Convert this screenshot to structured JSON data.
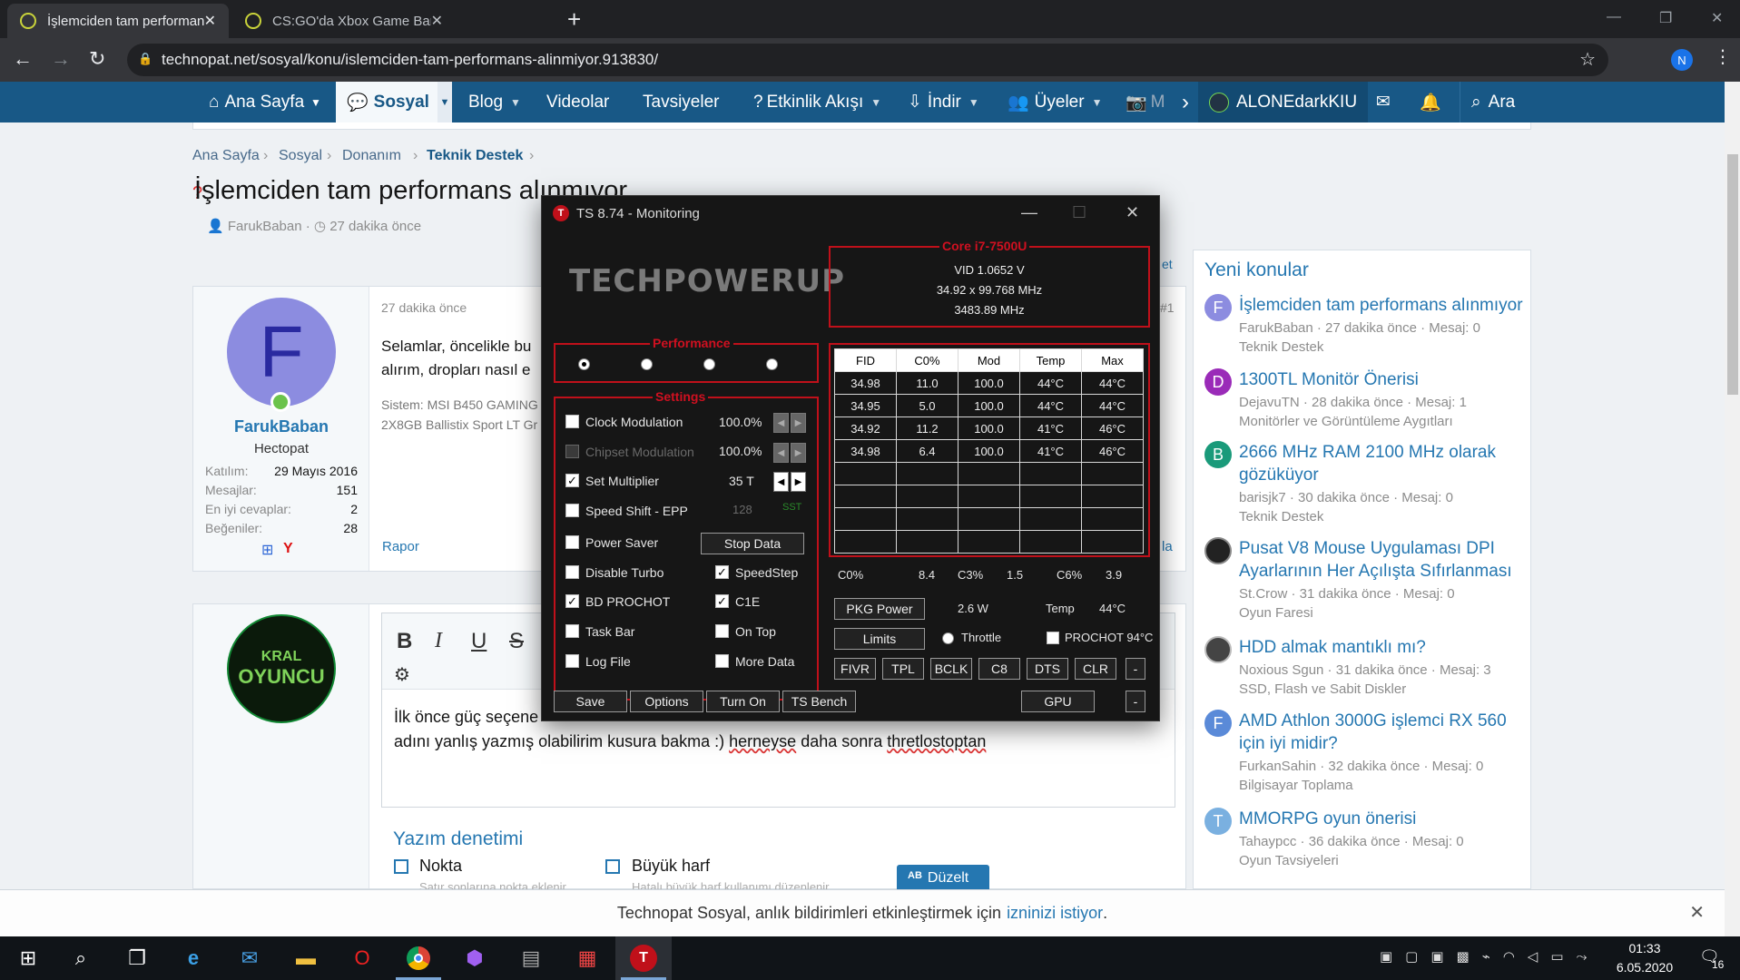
{
  "browser": {
    "tabs": [
      {
        "label": "İşlemciden tam performans alınm"
      },
      {
        "label": "CS:GO'da Xbox Game Bar'dan ka"
      }
    ],
    "url": "technopat.net/sosyal/konu/islemciden-tam-performans-alinmiyor.913830/",
    "profile_initial": "N"
  },
  "sitenav": {
    "items": [
      "Ana Sayfa",
      "Sosyal",
      "Blog",
      "Videolar",
      "Tavsiyeler",
      "Etkinlik Akışı",
      "İndir",
      "Üyeler",
      "M"
    ],
    "user": "ALONEdarkKIU",
    "search": "Ara"
  },
  "breadcrumb": [
    "Ana Sayfa",
    "Sosyal",
    "Donanım",
    "Teknik Destek"
  ],
  "thread": {
    "title": "İşlemciden tam performans alınmıyor",
    "author": "FarukBaban",
    "time": "27 dakika önce"
  },
  "post": {
    "time": "27 dakika önce",
    "number": "#1",
    "avatar_initial": "F",
    "username": "FarukBaban",
    "rank": "Hectopat",
    "stats": [
      {
        "label": "Katılım:",
        "value": "29 Mayıs 2016"
      },
      {
        "label": "Mesajlar:",
        "value": "151"
      },
      {
        "label": "En iyi cevaplar:",
        "value": "2"
      },
      {
        "label": "Beğeniler:",
        "value": "28"
      }
    ],
    "text_line1": "Selamlar, öncelikle bu",
    "text_line2": "alırım, dropları nasıl e",
    "system_line1": "Sistem: MSI B450 GAMING",
    "system_line2": "2X8GB Ballistix Sport LT Gr",
    "report": "Rapor",
    "right_fragment": "la",
    "tab_fragment": "et"
  },
  "reply": {
    "avatar_text1": "KRAL",
    "avatar_text2": "OYUNCU",
    "line1": "İlk önce güç seçene",
    "line2_pre": "adını yanlış yazmış olabilirim kusura bakma :) ",
    "line2_w1": "herneyse",
    "line2_mid": " daha sonra ",
    "line2_w2": "thretlostoptan"
  },
  "spellcheck": {
    "title": "Yazım denetimi",
    "opt1": "Nokta",
    "opt1_sub": "Satır sonlarına nokta eklenir",
    "opt2": "Büyük harf",
    "opt2_sub": "Hatalı büyük harf kullanımı düzenlenir",
    "fix": "Düzelt"
  },
  "sidebar": {
    "title": "Yeni konular",
    "items": [
      {
        "initial": "F",
        "color": "#8c8ce0",
        "title": "İşlemciden tam performans alınmıyor",
        "meta1": "FarukBaban · 27 dakika önce · Mesaj: 0",
        "meta2": "Teknik Destek"
      },
      {
        "initial": "D",
        "color": "#9a2bb8",
        "title": "1300TL Monitör Önerisi",
        "meta1": "DejavuTN · 28 dakika önce · Mesaj: 1",
        "meta2": "Monitörler ve Görüntüleme Aygıtları"
      },
      {
        "initial": "B",
        "color": "#1a9a7a",
        "title": "2666 MHz RAM 2100 MHz olarak gözüküyor",
        "meta1": "barisjk7 · 30 dakika önce · Mesaj: 0",
        "meta2": "Teknik Destek"
      },
      {
        "initial": "",
        "color": "#222",
        "title": "Pusat V8 Mouse Uygulaması DPI Ayarlarının Her Açılışta Sıfırlanması",
        "meta1": "St.Crow · 31 dakika önce · Mesaj: 0",
        "meta2": "Oyun Faresi"
      },
      {
        "initial": "",
        "color": "#444",
        "title": "HDD almak mantıklı mı?",
        "meta1": "Noxious Sgun · 31 dakika önce · Mesaj: 3",
        "meta2": "SSD, Flash ve Sabit Diskler"
      },
      {
        "initial": "F",
        "color": "#5a8ad8",
        "title": "AMD Athlon 3000G işlemci RX 560 için iyi midir?",
        "meta1": "FurkanSahin · 32 dakika önce · Mesaj: 0",
        "meta2": "Bilgisayar Toplama"
      },
      {
        "initial": "T",
        "color": "#7ab0e0",
        "title": "MMORPG oyun önerisi",
        "meta1": "Tahaypcc · 36 dakika önce · Mesaj: 0",
        "meta2": "Oyun Tavsiyeleri"
      }
    ]
  },
  "notice": {
    "text": "Technopat Sosyal, anlık bildirimleri etkinleştirmek için",
    "link": "izninizi istiyor",
    "end": "."
  },
  "ts": {
    "title": "TS 8.74 - Monitoring",
    "logo_text": "TECHPOWERUP",
    "cpu": "Core i7-7500U",
    "vid": "VID  1.0652 V",
    "mult": "34.92 x 99.768 MHz",
    "freq": "3483.89 MHz",
    "performance_label": "Performance",
    "settings_label": "Settings",
    "settings": [
      {
        "label": "Clock Modulation",
        "value": "100.0%",
        "checked": false,
        "disabled": false
      },
      {
        "label": "Chipset Modulation",
        "value": "100.0%",
        "checked": false,
        "disabled": true
      },
      {
        "label": "Set Multiplier",
        "value": "35 T",
        "checked": true,
        "disabled": false
      },
      {
        "label": "Speed Shift - EPP",
        "value": "128",
        "extra": "SST",
        "checked": false,
        "disabled": false
      }
    ],
    "checks_left": [
      {
        "label": "Power Saver",
        "checked": false
      },
      {
        "label": "Disable Turbo",
        "checked": false
      },
      {
        "label": "BD PROCHOT",
        "checked": true
      },
      {
        "label": "Task Bar",
        "checked": false
      },
      {
        "label": "Log File",
        "checked": false
      }
    ],
    "checks_right": [
      {
        "label": "SpeedStep",
        "checked": true
      },
      {
        "label": "C1E",
        "checked": true
      },
      {
        "label": "On Top",
        "checked": false
      },
      {
        "label": "More Data",
        "checked": false
      }
    ],
    "stop_data": "Stop Data",
    "table_header": [
      "FID",
      "C0%",
      "Mod",
      "Temp",
      "Max"
    ],
    "table_rows": [
      [
        "34.98",
        "11.0",
        "100.0",
        "44°C",
        "44°C"
      ],
      [
        "34.95",
        "5.0",
        "100.0",
        "44°C",
        "44°C"
      ],
      [
        "34.92",
        "11.2",
        "100.0",
        "41°C",
        "46°C"
      ],
      [
        "34.98",
        "6.4",
        "100.0",
        "41°C",
        "46°C"
      ]
    ],
    "cstates": [
      {
        "label": "C0%",
        "value": "8.4"
      },
      {
        "label": "C3%",
        "value": "1.5"
      },
      {
        "label": "C6%",
        "value": "3.9"
      }
    ],
    "pkg_power": "PKG Power",
    "power_value": "2.6 W",
    "temp_label": "Temp",
    "temp_value": "44°C",
    "limits": "Limits",
    "throttle": "Throttle",
    "prochot": "PROCHOT 94°C",
    "small_buttons": [
      "FIVR",
      "TPL",
      "BCLK",
      "C8",
      "DTS",
      "CLR",
      "-"
    ],
    "bottom_buttons": [
      "Save",
      "Options",
      "Turn On",
      "TS Bench"
    ],
    "gpu": "GPU",
    "dash": "-"
  },
  "clock": {
    "time": "01:33",
    "date": "6.05.2020",
    "badge": "16"
  }
}
